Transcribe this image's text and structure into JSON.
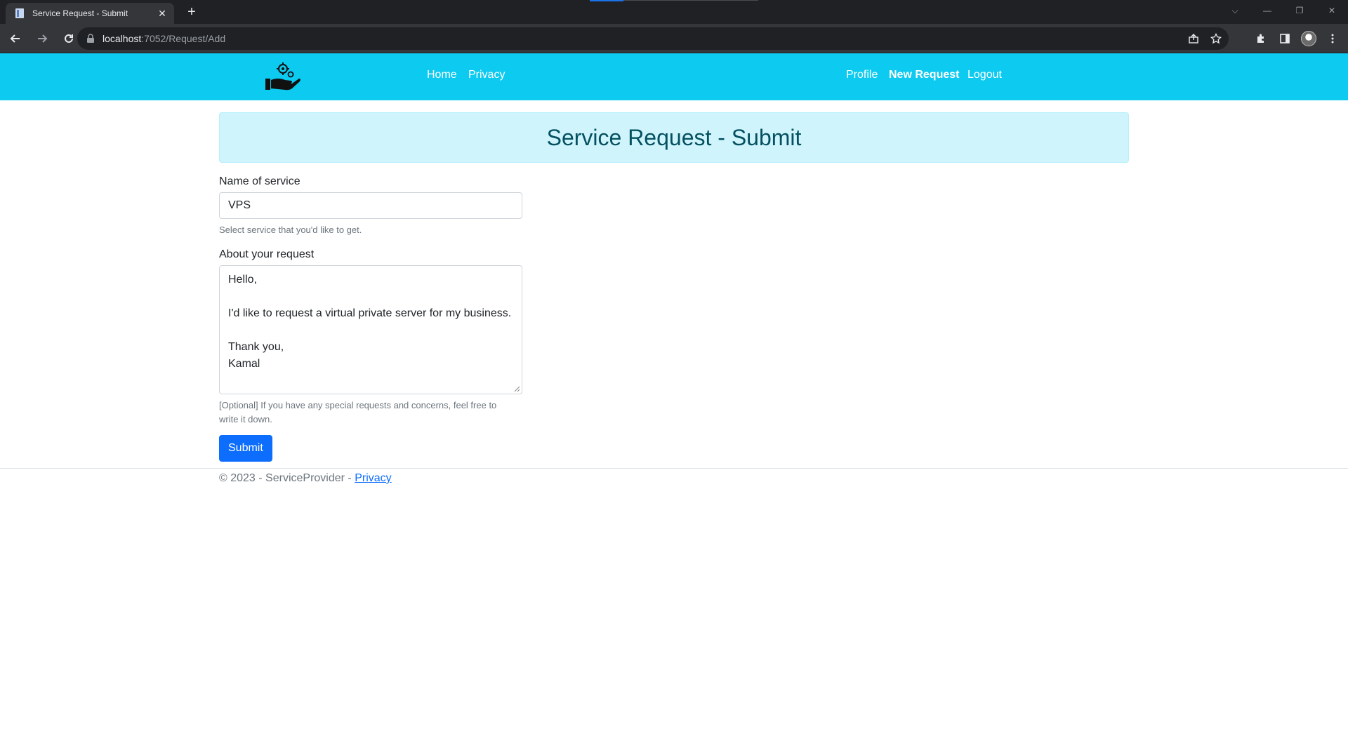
{
  "browser": {
    "tab_title": "Service Request - Submit",
    "url_host": "localhost",
    "url_path": ":7052/Request/Add"
  },
  "navbar": {
    "home": "Home",
    "privacy": "Privacy",
    "profile": "Profile",
    "new_request": "New Request",
    "logout": "Logout"
  },
  "main": {
    "title": "Service Request - Submit",
    "service_label": "Name of service",
    "service_value": "VPS",
    "service_help": "Select service that you'd like to get.",
    "about_label": "About your request",
    "about_lines": [
      "Hello,",
      "",
      "I'd like to request a virtual private server for my business.",
      "",
      "Thank you,",
      "Kamal"
    ],
    "about_help_1": "[Optional] If you have any special requests and concerns, feel free to",
    "about_help_2": "write it down.",
    "submit_label": "Submit"
  },
  "footer": {
    "text": "© 2023 - ServiceProvider - ",
    "privacy_link": "Privacy"
  },
  "colors": {
    "navbar": "#0dcaf0",
    "alert_bg": "#cff4fc",
    "alert_text": "#055160",
    "primary": "#0d6efd"
  }
}
